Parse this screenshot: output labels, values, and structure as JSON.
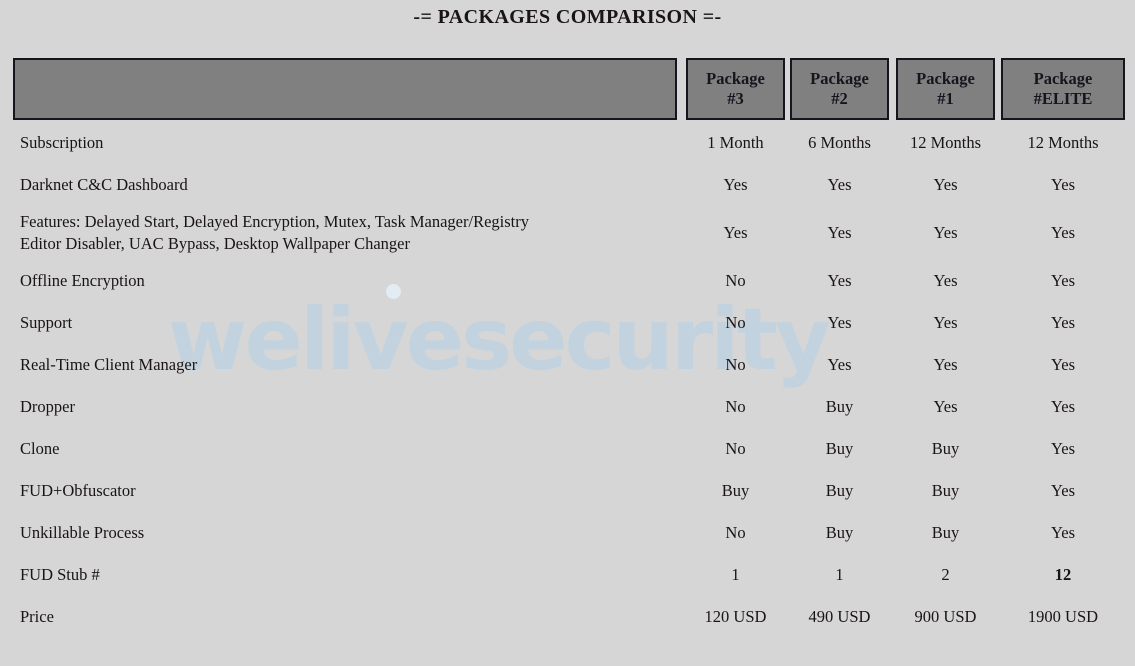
{
  "title": "-= PACKAGES COMPARISON =-",
  "watermark": {
    "text": "welivesecurity",
    "color": "#c2d3df"
  },
  "colors": {
    "page_background": "#d6d6d6",
    "header_fill": "#808080",
    "header_border": "#15151d",
    "text": "#1a1414"
  },
  "table": {
    "header": {
      "label_column": "",
      "columns": [
        {
          "line1": "Package",
          "line2": "#3"
        },
        {
          "line1": "Package",
          "line2": "#2"
        },
        {
          "line1": "Package",
          "line2": "#1"
        },
        {
          "line1": "Package",
          "line2": "#ELITE"
        }
      ]
    },
    "rows": [
      {
        "label": "Subscription",
        "label_line2": "",
        "values": [
          "1 Month",
          "6 Months",
          "12 Months",
          "12 Months"
        ],
        "bold": [
          false,
          false,
          false,
          false
        ]
      },
      {
        "label": "Darknet C&C Dashboard",
        "label_line2": "",
        "values": [
          "Yes",
          "Yes",
          "Yes",
          "Yes"
        ],
        "bold": [
          false,
          false,
          false,
          false
        ]
      },
      {
        "label": "Features: Delayed Start, Delayed Encryption, Mutex, Task Manager/Registry",
        "label_line2": "Editor Disabler, UAC Bypass, Desktop Wallpaper Changer",
        "values": [
          "Yes",
          "Yes",
          "Yes",
          "Yes"
        ],
        "bold": [
          false,
          false,
          false,
          false
        ]
      },
      {
        "label": "Offline Encryption",
        "label_line2": "",
        "values": [
          "No",
          "Yes",
          "Yes",
          "Yes"
        ],
        "bold": [
          false,
          false,
          false,
          false
        ]
      },
      {
        "label": "Support",
        "label_line2": "",
        "values": [
          "No",
          "Yes",
          "Yes",
          "Yes"
        ],
        "bold": [
          false,
          false,
          false,
          false
        ]
      },
      {
        "label": "Real-Time Client Manager",
        "label_line2": "",
        "values": [
          "No",
          "Yes",
          "Yes",
          "Yes"
        ],
        "bold": [
          false,
          false,
          false,
          false
        ]
      },
      {
        "label": "Dropper",
        "label_line2": "",
        "values": [
          "No",
          "Buy",
          "Yes",
          "Yes"
        ],
        "bold": [
          false,
          false,
          false,
          false
        ]
      },
      {
        "label": "Clone",
        "label_line2": "",
        "values": [
          "No",
          "Buy",
          "Buy",
          "Yes"
        ],
        "bold": [
          false,
          false,
          false,
          false
        ]
      },
      {
        "label": "FUD+Obfuscator",
        "label_line2": "",
        "values": [
          "Buy",
          "Buy",
          "Buy",
          "Yes"
        ],
        "bold": [
          false,
          false,
          false,
          false
        ]
      },
      {
        "label": "Unkillable Process",
        "label_line2": "",
        "values": [
          "No",
          "Buy",
          "Buy",
          "Yes"
        ],
        "bold": [
          false,
          false,
          false,
          false
        ]
      },
      {
        "label": "FUD Stub #",
        "label_line2": "",
        "values": [
          "1",
          "1",
          "2",
          "12"
        ],
        "bold": [
          false,
          false,
          false,
          true
        ]
      },
      {
        "label": "Price",
        "label_line2": "",
        "values": [
          "120 USD",
          "490 USD",
          "900 USD",
          "1900 USD"
        ],
        "bold": [
          false,
          false,
          false,
          false
        ]
      }
    ]
  }
}
